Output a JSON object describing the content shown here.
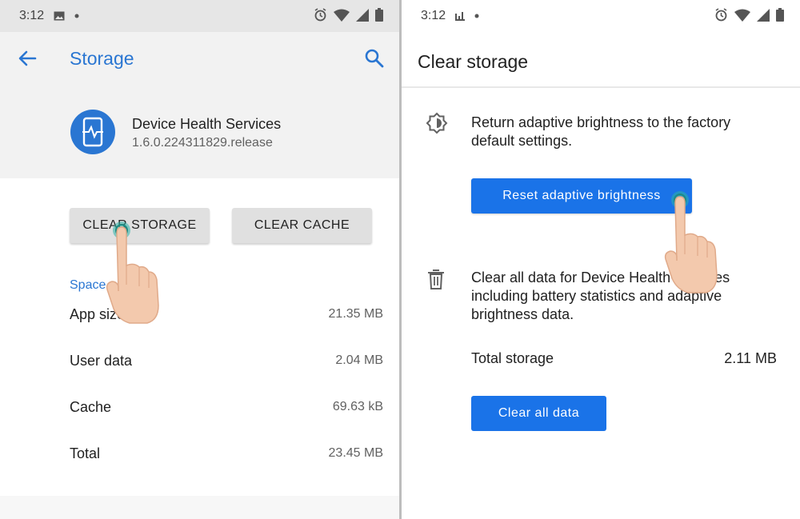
{
  "left": {
    "status": {
      "time": "3:12",
      "icons": [
        "image-icon",
        "dot-icon",
        "alarm-icon",
        "wifi-icon",
        "signal-icon",
        "battery-icon"
      ]
    },
    "header": {
      "title": "Storage"
    },
    "app": {
      "name": "Device Health Services",
      "version": "1.6.0.224311829.release"
    },
    "buttons": {
      "clear_storage": "CLEAR STORAGE",
      "clear_cache": "CLEAR CACHE"
    },
    "space": {
      "label": "Space",
      "rows": [
        {
          "label": "App size",
          "value": "21.35 MB"
        },
        {
          "label": "User data",
          "value": "2.04 MB"
        },
        {
          "label": "Cache",
          "value": "69.63 kB"
        },
        {
          "label": "Total",
          "value": "23.45 MB"
        }
      ]
    }
  },
  "right": {
    "status": {
      "time": "3:12",
      "icons": [
        "chart-icon",
        "dot-icon",
        "alarm-icon",
        "wifi-icon",
        "signal-icon",
        "battery-icon"
      ]
    },
    "header": {
      "title": "Clear storage"
    },
    "brightness": {
      "text": "Return adaptive brightness to the factory default settings.",
      "button": "Reset adaptive brightness"
    },
    "clear_data": {
      "text": "Clear all data for Device Health Services including battery statistics and adaptive brightness data.",
      "total_label": "Total storage",
      "total_value": "2.11 MB",
      "button": "Clear all data"
    }
  },
  "colors": {
    "accent": "#2a76d2",
    "button_blue": "#1a73e8",
    "header_grey": "#f2f2f2"
  }
}
